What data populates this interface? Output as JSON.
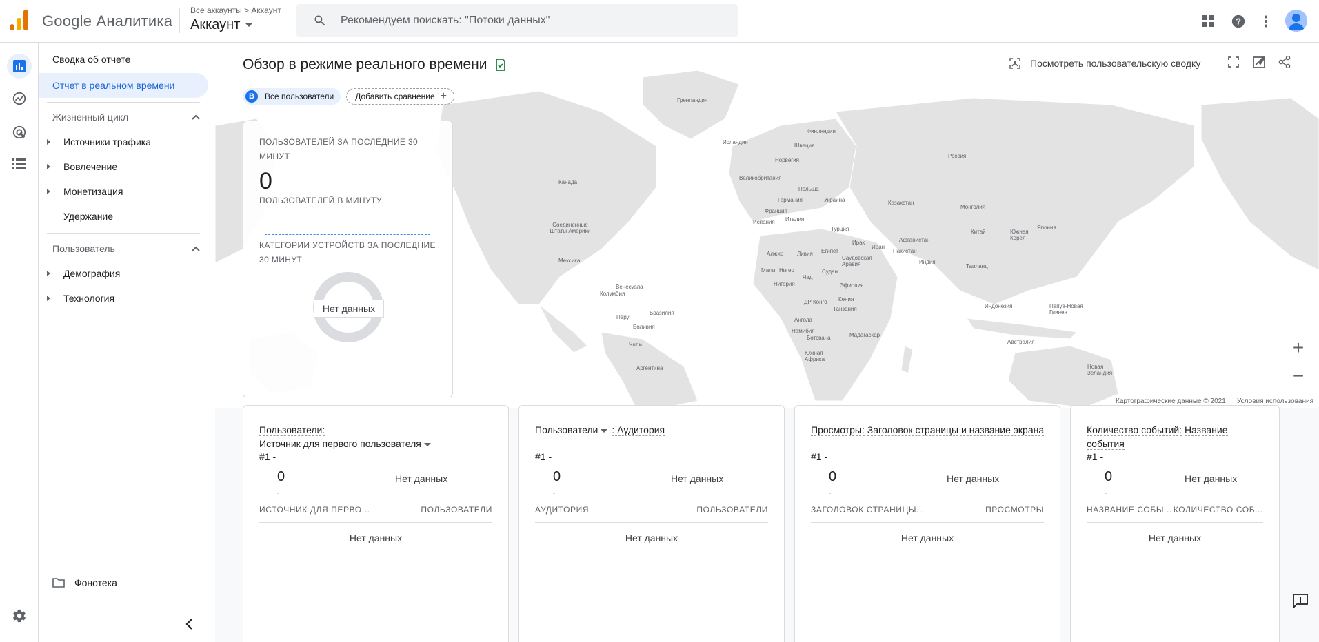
{
  "app": {
    "brand": "Google Аналитика",
    "breadcrumb": "Все аккаунты > Аккаунт",
    "account": "Аккаунт",
    "search_placeholder": "Рекомендуем поискать: \"Потоки данных\""
  },
  "nav": {
    "items": [
      {
        "label": "Сводка об отчете"
      },
      {
        "label": "Отчет в реальном времени",
        "active": true
      }
    ],
    "lifecycle": {
      "label": "Жизненный цикл",
      "children": [
        "Источники трафика",
        "Вовлечение",
        "Монетизация",
        "Удержание"
      ]
    },
    "user": {
      "label": "Пользователь",
      "children": [
        "Демография",
        "Технология"
      ]
    },
    "library": "Фонотека"
  },
  "main": {
    "title": "Обзор в режиме реального времени",
    "chip_all_badge": "B",
    "chip_all": "Все пользователи",
    "chip_add": "Добавить сравнение",
    "user_snapshot": "Посмотреть пользовательскую сводку",
    "realtime": {
      "users30": "ПОЛЬЗОВАТЕЛЕЙ ЗА ПОСЛЕДНИЕ 30 МИНУТ",
      "users30_value": "0",
      "per_minute": "ПОЛЬЗОВАТЕЛЕЙ В МИНУТУ",
      "devices": "КАТЕГОРИИ УСТРОЙСТВ ЗА ПОСЛЕДНИЕ 30 МИНУТ",
      "no_data": "Нет данных"
    },
    "map_footer": {
      "attribution": "Картографические данные © 2021",
      "terms": "Условия использования"
    },
    "countries": [
      "Гренландия",
      "Исландия",
      "Финляндия",
      "Швеция",
      "Норвегия",
      "Россия",
      "Канада",
      "Великобритания",
      "Польша",
      "Германия",
      "Украина",
      "Казахстан",
      "Франция",
      "Италия",
      "Испания",
      "Монголия",
      "Соединенные Штаты Америки",
      "Турция",
      "Китай",
      "Южная Корея",
      "Япония",
      "Ирак",
      "Иран",
      "Афганистан",
      "Пакистан",
      "Алжир",
      "Ливия",
      "Египет",
      "Саудовская Аравия",
      "Индия",
      "Мексика",
      "Таиланд",
      "Мали",
      "Нигер",
      "Чад",
      "Судан",
      "Нигерия",
      "Эфиопия",
      "Венесуэла",
      "Колумбия",
      "ДР Конго",
      "Кения",
      "Танзания",
      "Индонезия",
      "Папуа-Новая Гвинея",
      "Бразилия",
      "Перу",
      "Боливия",
      "Ангола",
      "Намибия",
      "Ботсвана",
      "Мадагаскар",
      "Чили",
      "Австралия",
      "Южная Африка",
      "Аргентина",
      "Новая Зеландия"
    ]
  },
  "cards": [
    {
      "title_parts": [
        "Пользователи:",
        "Источник для первого пользователя"
      ],
      "rank": "#1 -",
      "value": "0",
      "dot": "-",
      "no_data": "Нет данных",
      "col1": "ИСТОЧНИК ДЛЯ ПЕРВО...",
      "col2": "ПОЛЬЗОВАТЕЛИ",
      "empty": "Нет данных"
    },
    {
      "title_parts": [
        "Пользователи",
        ": Аудитория"
      ],
      "rank": "#1 -",
      "value": "0",
      "dot": "-",
      "no_data": "Нет данных",
      "col1": "АУДИТОРИЯ",
      "col2": "ПОЛЬЗОВАТЕЛИ",
      "empty": "Нет данных"
    },
    {
      "title_parts": [
        "Просмотры:",
        "Заголовок страницы и название экрана"
      ],
      "rank": "#1 -",
      "value": "0",
      "dot": "-",
      "no_data": "Нет данных",
      "col1": "ЗАГОЛОВОК СТРАНИЦЫ...",
      "col2": "ПРОСМОТРЫ",
      "empty": "Нет данных"
    },
    {
      "title_parts": [
        "Количество событий:",
        "Название события"
      ],
      "rank": "#1 -",
      "value": "0",
      "dot": "-",
      "no_data": "Нет данных",
      "col1": "НАЗВАНИЕ СОБЫ...",
      "col2": "КОЛИЧЕСТВО СОБ...",
      "empty": "Нет данных"
    }
  ],
  "colors": {
    "accent": "#1a73e8",
    "active_bg": "#e8f0fe",
    "check": "#188038",
    "logo_orange": "#f9ab00",
    "logo_dark": "#e37400"
  }
}
